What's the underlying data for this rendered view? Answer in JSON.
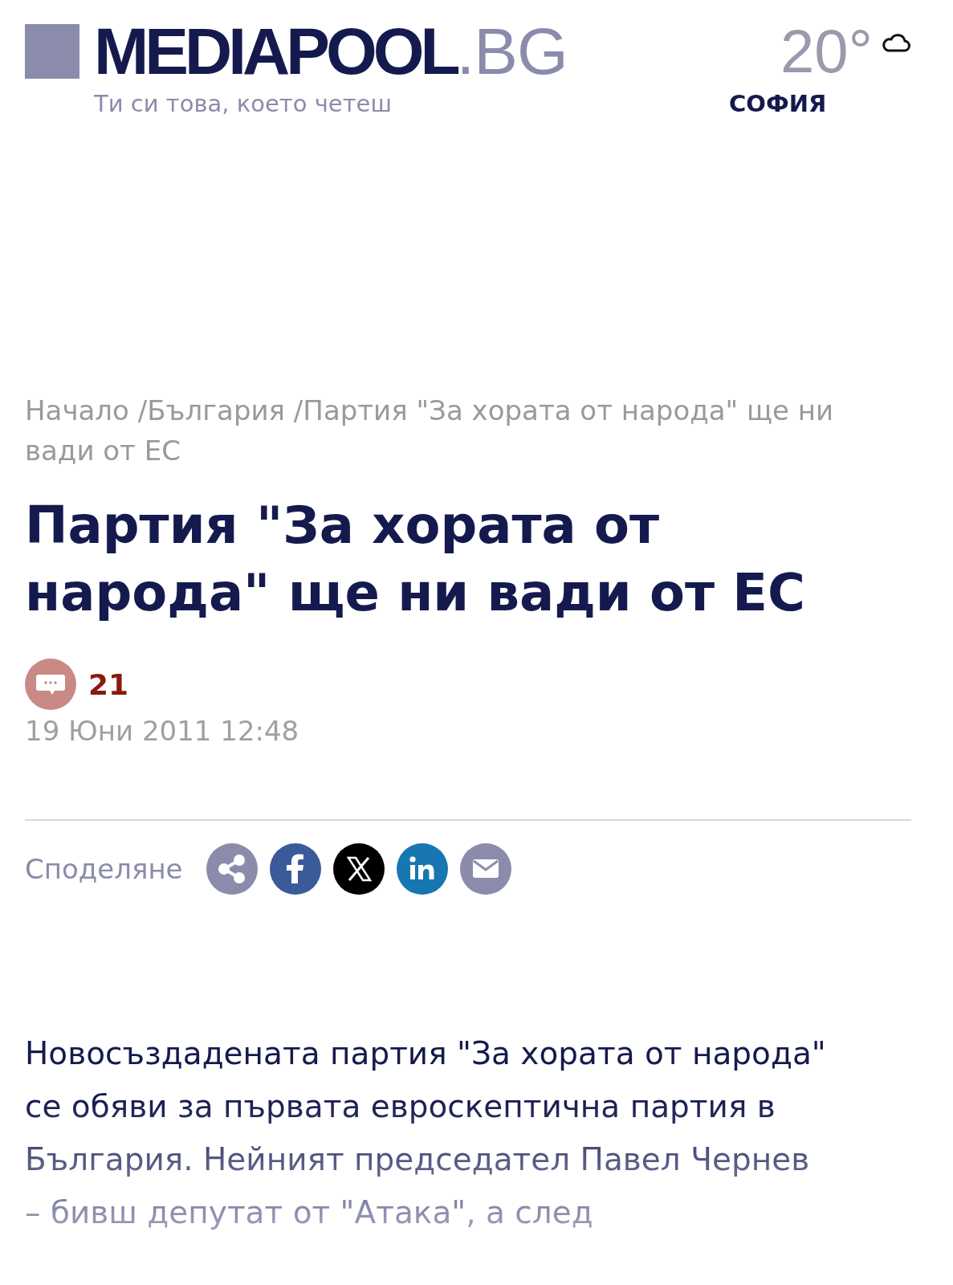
{
  "header": {
    "logo": {
      "name": "MEDIAPOOL",
      "suffix": ".BG"
    },
    "tagline": "Ти си това, което четеш",
    "weather": {
      "temperature": "20°",
      "city": "СОФИЯ"
    }
  },
  "breadcrumb": {
    "separator": "/",
    "links": [
      "Начало",
      "България"
    ],
    "current": "Партия \"За хората от народа\" ще ни вади от ЕС"
  },
  "article": {
    "title": "Партия \"За хората от народа\" ще ни вади от ЕС",
    "comments": "21",
    "date": "19 Юни 2011 12:48",
    "share": {
      "label": "Споделяне",
      "buttons": [
        {
          "kind": "share"
        },
        {
          "kind": "facebook"
        },
        {
          "kind": "x"
        },
        {
          "kind": "linkedin"
        },
        {
          "kind": "email"
        }
      ]
    },
    "body": "Новосъздадената партия \"За хората от народа\" се обяви за първата евроскептична партия в България. Нейният председател Павел Чернев – бивш депутат от \"Атака\", а след"
  }
}
